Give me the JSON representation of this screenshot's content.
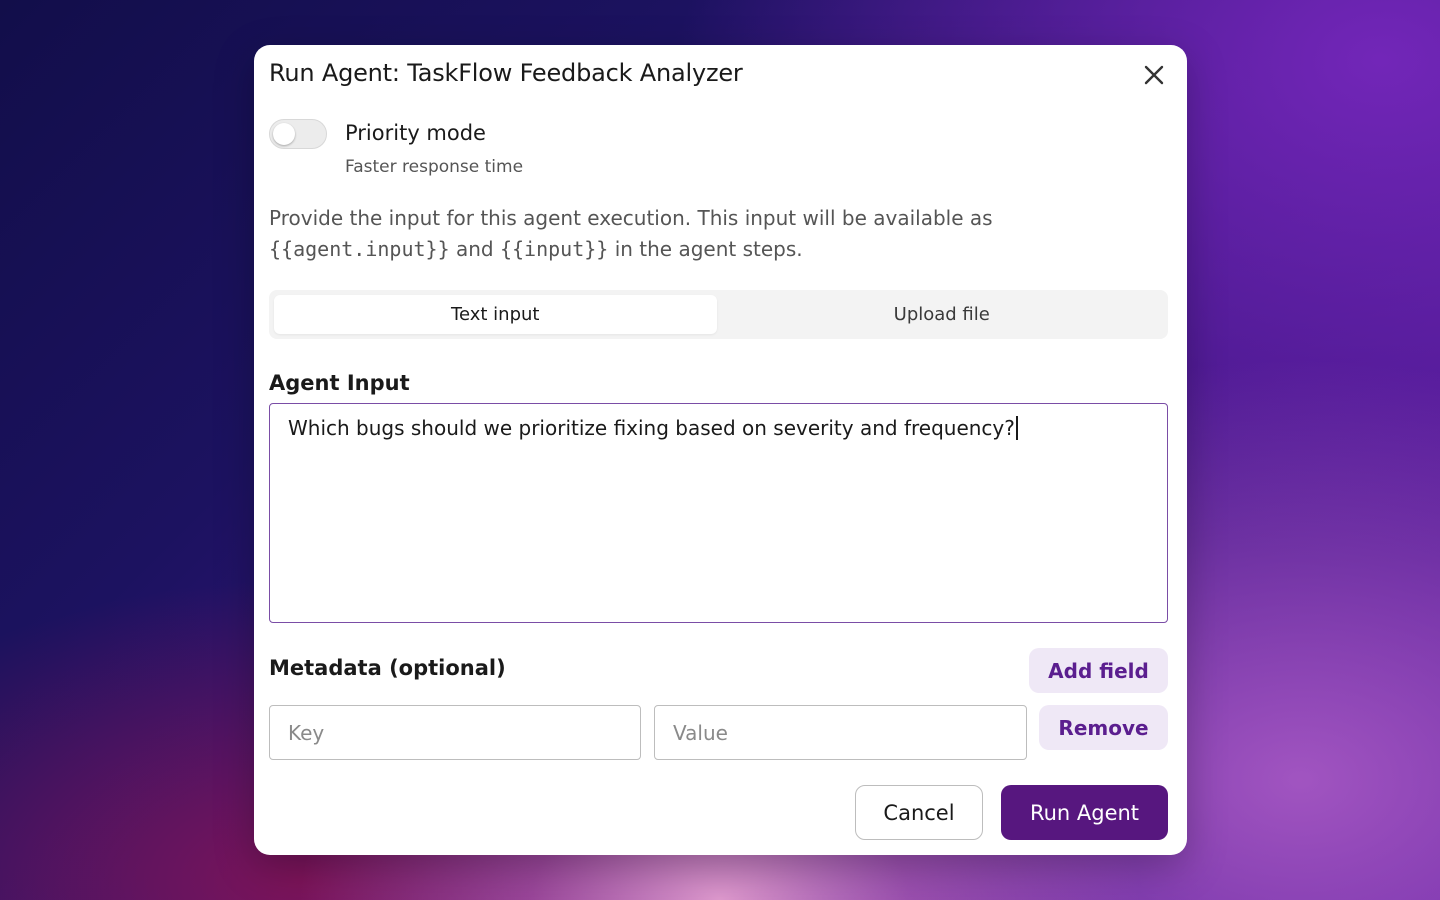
{
  "dialog": {
    "title": "Run Agent: TaskFlow Feedback Analyzer",
    "close_icon": "close-icon"
  },
  "priority": {
    "label": "Priority mode",
    "sublabel": "Faster response time",
    "enabled": false
  },
  "description": {
    "part1": "Provide the input for this agent execution. This input will be available as",
    "code1": "{{agent.input}}",
    "part2": " and ",
    "code2": "{{input}}",
    "part3": " in the agent steps."
  },
  "tabs": [
    {
      "label": "Text input",
      "active": true
    },
    {
      "label": "Upload file",
      "active": false
    }
  ],
  "agent_input": {
    "label": "Agent Input",
    "value": "Which bugs should we prioritize fixing based on severity and frequency?"
  },
  "metadata": {
    "label": "Metadata (optional)",
    "add_label": "Add field",
    "key_placeholder": "Key",
    "value_placeholder": "Value",
    "remove_label": "Remove"
  },
  "footer": {
    "cancel_label": "Cancel",
    "run_label": "Run Agent"
  },
  "colors": {
    "accent": "#57177f",
    "accent_soft": "#efe8f6",
    "input_focus_border": "#7a4da6"
  }
}
